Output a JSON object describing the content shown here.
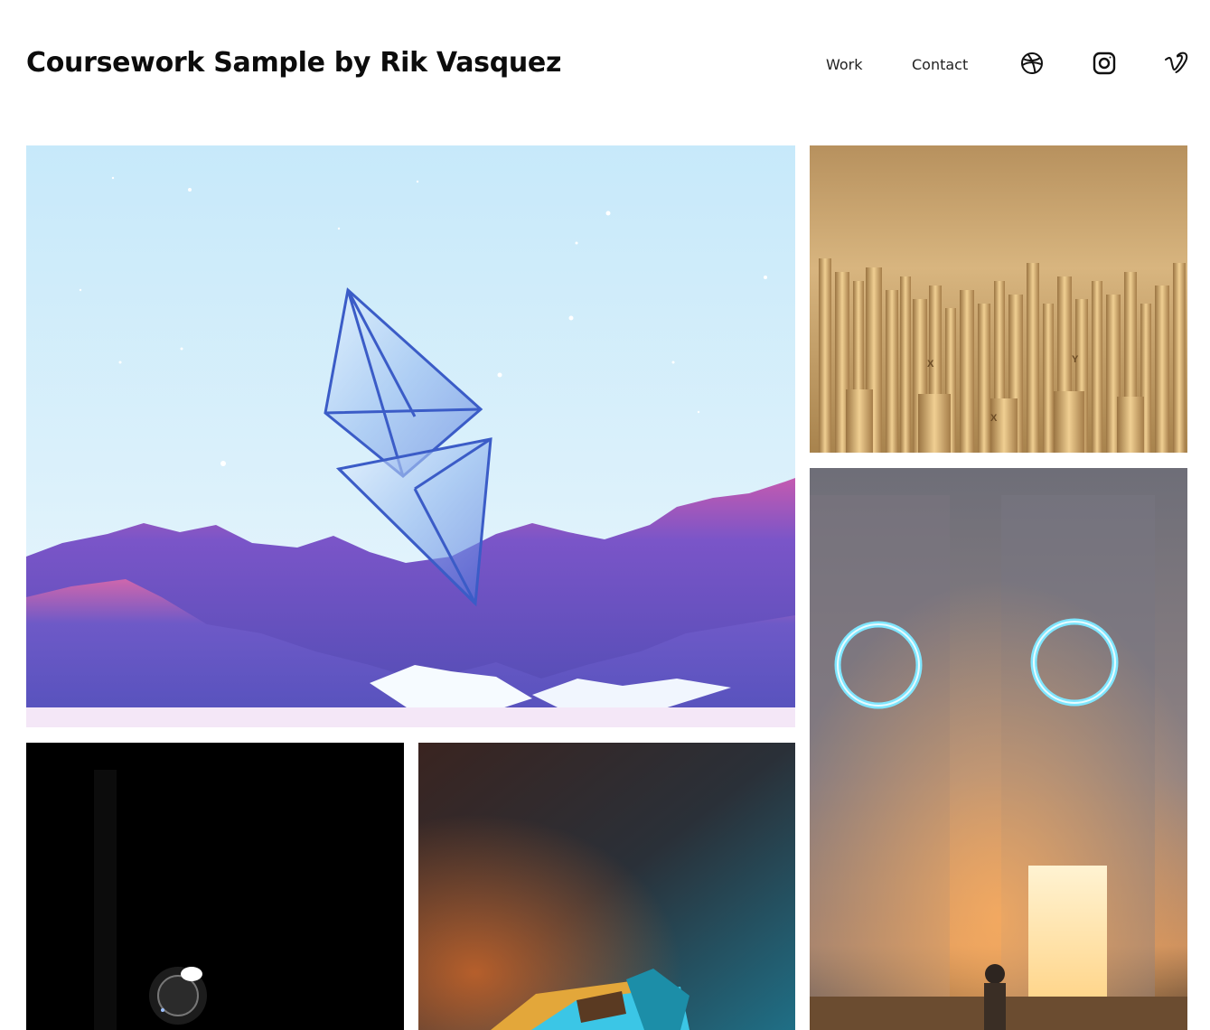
{
  "header": {
    "title": "Coursework Sample by Rik Vasquez",
    "nav": [
      {
        "label": "Work"
      },
      {
        "label": "Contact"
      }
    ],
    "social": [
      {
        "icon": "dribbble-icon"
      },
      {
        "icon": "instagram-icon"
      },
      {
        "icon": "vimeo-icon"
      }
    ]
  },
  "gallery": {
    "items": [
      {
        "subject": "crystal diamond shape floating over purple mountains"
      },
      {
        "subject": "golden cylinders with engraved letters"
      },
      {
        "subject": "astronaut before glowing doorway under two neon rings"
      },
      {
        "subject": "astronaut helmet in darkness"
      },
      {
        "subject": "teal and orange blocks"
      }
    ]
  },
  "colors": {
    "title": "#0c0c0c",
    "nav_text": "#222222",
    "background": "#ffffff"
  }
}
